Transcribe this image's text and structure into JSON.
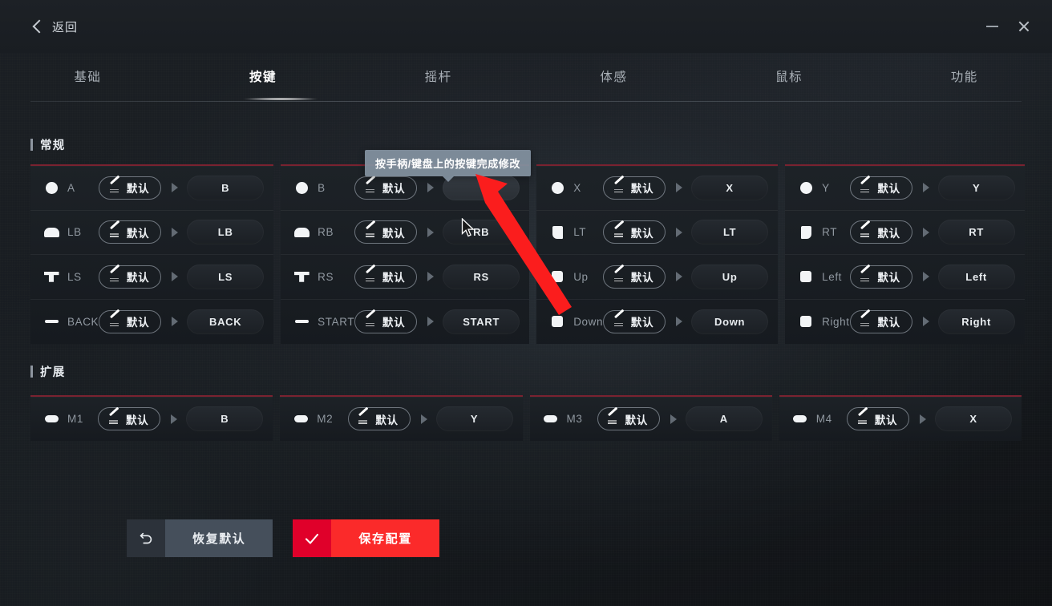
{
  "window": {
    "back_label": "返回",
    "back_icon": "chevron-left-icon",
    "minimize_icon": "minimize-icon",
    "close_icon": "close-icon"
  },
  "tabs": [
    {
      "label": "基础",
      "active": false
    },
    {
      "label": "按键",
      "active": true
    },
    {
      "label": "摇杆",
      "active": false
    },
    {
      "label": "体感",
      "active": false
    },
    {
      "label": "鼠标",
      "active": false
    },
    {
      "label": "功能",
      "active": false
    }
  ],
  "tooltip": {
    "text": "按手柄/键盘上的按键完成修改"
  },
  "sections": [
    {
      "title": "常规",
      "cards": [
        {
          "rows": [
            {
              "icon": "face-button-icon",
              "label": "A",
              "default_label": "默认",
              "value": "B"
            },
            {
              "icon": "left-bumper-icon",
              "label": "LB",
              "default_label": "默认",
              "value": "LB"
            },
            {
              "icon": "left-stick-icon",
              "label": "LS",
              "default_label": "默认",
              "value": "LS"
            },
            {
              "icon": "back-button-icon",
              "label": "BACK",
              "default_label": "默认",
              "value": "BACK"
            }
          ]
        },
        {
          "rows": [
            {
              "icon": "face-button-icon",
              "label": "B",
              "default_label": "默认",
              "value": "",
              "editing": true
            },
            {
              "icon": "right-bumper-icon",
              "label": "RB",
              "default_label": "默认",
              "value": "RB"
            },
            {
              "icon": "right-stick-icon",
              "label": "RS",
              "default_label": "默认",
              "value": "RS"
            },
            {
              "icon": "start-button-icon",
              "label": "START",
              "default_label": "默认",
              "value": "START"
            }
          ]
        },
        {
          "rows": [
            {
              "icon": "face-button-icon",
              "label": "X",
              "default_label": "默认",
              "value": "X"
            },
            {
              "icon": "left-trigger-icon",
              "label": "LT",
              "default_label": "默认",
              "value": "LT"
            },
            {
              "icon": "dpad-up-icon",
              "label": "Up",
              "default_label": "默认",
              "value": "Up"
            },
            {
              "icon": "dpad-down-icon",
              "label": "Down",
              "default_label": "默认",
              "value": "Down"
            }
          ]
        },
        {
          "rows": [
            {
              "icon": "face-button-icon",
              "label": "Y",
              "default_label": "默认",
              "value": "Y"
            },
            {
              "icon": "right-trigger-icon",
              "label": "RT",
              "default_label": "默认",
              "value": "RT"
            },
            {
              "icon": "dpad-left-icon",
              "label": "Left",
              "default_label": "默认",
              "value": "Left"
            },
            {
              "icon": "dpad-right-icon",
              "label": "Right",
              "default_label": "默认",
              "value": "Right"
            }
          ]
        }
      ]
    },
    {
      "title": "扩展",
      "cards": [
        {
          "rows": [
            {
              "icon": "macro-button-icon",
              "label": "M1",
              "default_label": "默认",
              "value": "B"
            }
          ]
        },
        {
          "rows": [
            {
              "icon": "macro-button-icon",
              "label": "M2",
              "default_label": "默认",
              "value": "Y"
            }
          ]
        },
        {
          "rows": [
            {
              "icon": "macro-button-icon",
              "label": "M3",
              "default_label": "默认",
              "value": "A"
            }
          ]
        },
        {
          "rows": [
            {
              "icon": "macro-button-icon",
              "label": "M4",
              "default_label": "默认",
              "value": "X"
            }
          ]
        }
      ]
    }
  ],
  "footer": {
    "restore": {
      "label": "恢复默认",
      "icon": "undo-icon"
    },
    "save": {
      "label": "保存配置",
      "icon": "check-icon"
    }
  },
  "colors": {
    "accent_red": "#fb2a2a",
    "accent_red_dark": "#e0002a",
    "card_top_border": "#7a2230",
    "tooltip_bg": "#8392a0",
    "restore_bg": "#454f5b"
  }
}
